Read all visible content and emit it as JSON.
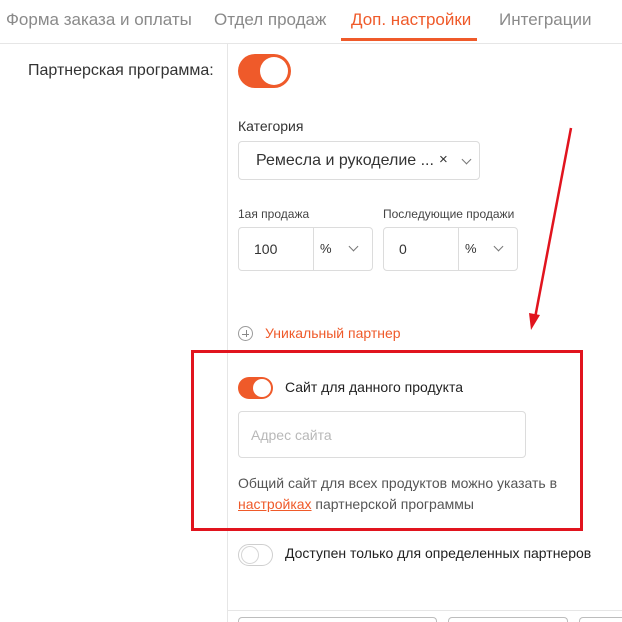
{
  "tabs": [
    {
      "label": "Форма заказа и оплаты"
    },
    {
      "label": "Отдел продаж"
    },
    {
      "label": "Доп. настройки"
    },
    {
      "label": "Интеграции"
    }
  ],
  "active_tab": "Доп. настройки",
  "accent_color": "#ef5a2a",
  "annotation_color": "#e1141e",
  "affiliate": {
    "label": "Партнерская программа:",
    "enabled": true
  },
  "category": {
    "label": "Категория",
    "value": "Ремесла и рукоделие ...",
    "clear_glyph": "×"
  },
  "first_sale": {
    "label": "1ая продажа",
    "value": "100",
    "unit": "%"
  },
  "next_sales": {
    "label": "Последующие продажи",
    "value": "0",
    "unit": "%"
  },
  "unique_partner": {
    "label": "Уникальный партнер"
  },
  "product_site": {
    "label": "Сайт для данного продукта",
    "enabled": true,
    "placeholder": "Адрес сайта",
    "hint_before": "Общий сайт для всех продуктов можно указать в ",
    "hint_link": "настройках",
    "hint_after": " партнерской программы"
  },
  "only_selected": {
    "label": "Доступен только для определенных партнеров",
    "enabled": false
  }
}
